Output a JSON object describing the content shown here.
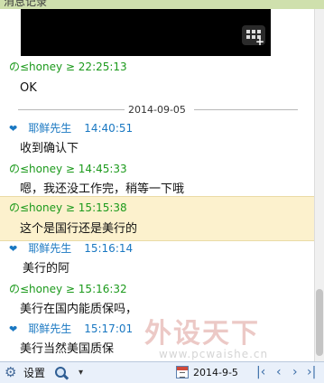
{
  "window": {
    "title": "消息记录"
  },
  "messages": [
    {
      "sender": "の≤honey ≥",
      "time": "22:25:13",
      "text": "OK",
      "side": "me"
    },
    {
      "sender": "耶鲜先生",
      "time": "14:40:51",
      "text": "收到确认下",
      "side": "peer"
    },
    {
      "sender": "の≤honey ≥",
      "time": "14:45:33",
      "text": "嗯，我还没工作完，稍等一下哦",
      "side": "me"
    },
    {
      "sender": "の≤honey ≥",
      "time": "15:15:38",
      "text": "这个是国行还是美行的",
      "side": "me",
      "highlighted": true
    },
    {
      "sender": "耶鲜先生",
      "time": "15:16:14",
      "text": "美行的阿",
      "side": "peer"
    },
    {
      "sender": "の≤honey ≥",
      "time": "15:16:32",
      "text": "美行在国内能质保吗，",
      "side": "me"
    },
    {
      "sender": "耶鲜先生",
      "time": "15:17:01",
      "text": "美行当然美国质保",
      "side": "peer"
    }
  ],
  "date_separator": "2014-09-05",
  "toolbar": {
    "settings_label": "设置",
    "date_value": "2014-9-5",
    "nav": {
      "first": "|‹",
      "prev": "‹",
      "next": "›",
      "last": "›|"
    }
  },
  "watermark": {
    "logo_text": "外设天下",
    "url_text": "www.pcwaishe.cn"
  },
  "icons": [
    "video-thumbnail-grid-icon",
    "heart-icon",
    "gear-icon",
    "search-icon",
    "calendar-icon"
  ],
  "colors": {
    "me_sender": "#1c9a1c",
    "peer_sender": "#1a78c2",
    "highlight_bg": "#fcf1cd",
    "titlebar_bg": "#cfe0ad"
  }
}
